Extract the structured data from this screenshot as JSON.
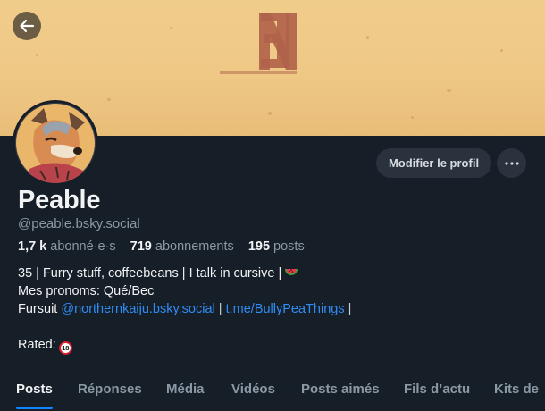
{
  "banner": {
    "art_text": "NE",
    "colors": {
      "paper": "#efc886",
      "ink": "#b0624a"
    }
  },
  "back_button": {
    "icon": "arrow-left-icon"
  },
  "profile": {
    "display_name": "Peable",
    "handle": "@peable.bsky.social",
    "stats": {
      "followers_count": "1,7 k",
      "followers_label": "abonné·e·s",
      "following_count": "719",
      "following_label": "abonnements",
      "posts_count": "195",
      "posts_label": "posts"
    },
    "bio": {
      "line1": "35 | Furry stuff, coffeebeans | I talk in cursive |",
      "line1_emoji": "watermelon-icon",
      "line2": "Mes pronoms: Qué/Bec",
      "line3_prefix": "Fursuit ",
      "line3_link1": "@northernkaiju.bsky.social",
      "line3_sep": " | ",
      "line3_link2": "t.me/BullyPeaThings",
      "line3_suffix": " |",
      "line4": "Rated:",
      "rated_badge": "18"
    }
  },
  "actions": {
    "edit_label": "Modifier le profil",
    "more_icon": "ellipsis-icon"
  },
  "tabs": [
    {
      "label": "Posts",
      "active": true
    },
    {
      "label": "Réponses",
      "active": false
    },
    {
      "label": "Média",
      "active": false
    },
    {
      "label": "Vidéos",
      "active": false
    },
    {
      "label": "Posts aimés",
      "active": false
    },
    {
      "label": "Fils d’actu",
      "active": false
    },
    {
      "label": "Kits de",
      "active": false
    }
  ],
  "colors": {
    "background": "#161e27",
    "link": "#2f8df6",
    "accent": "#1083fe",
    "muted": "#8b98a5"
  }
}
